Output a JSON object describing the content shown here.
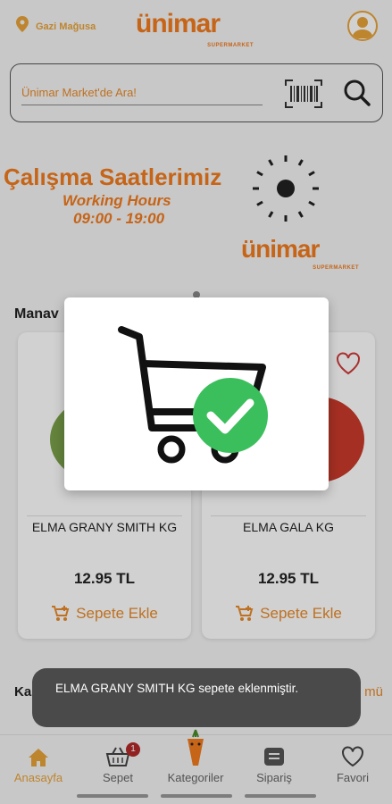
{
  "header": {
    "location": "Gazi Mağusa",
    "logo_text": "ünimar",
    "logo_sub": "SUPERMARKET"
  },
  "search": {
    "placeholder": "Ünimar Market'de Ara!"
  },
  "banner": {
    "title": "Çalışma Saatlerimiz",
    "subtitle": "Working Hours",
    "hours": "09:00 - 19:00",
    "logo_text": "ünimar",
    "logo_sub": "SUPERMARKET"
  },
  "section": {
    "title": "Manav"
  },
  "products": [
    {
      "name": "ELMA GRANY SMITH KG",
      "price": "12.95 TL",
      "add_label": "Sepete Ekle"
    },
    {
      "name": "ELMA GALA KG",
      "price": "12.95 TL",
      "add_label": "Sepete Ekle"
    }
  ],
  "section2": {
    "title": "Ka",
    "link": "mü"
  },
  "toast": {
    "message": "ELMA GRANY SMITH KG sepete eklenmiştir."
  },
  "nav": {
    "items": [
      {
        "label": "Anasayfa",
        "icon": "home-icon"
      },
      {
        "label": "Sepet",
        "icon": "basket-icon",
        "badge": "1"
      },
      {
        "label": "Kategoriler",
        "icon": "carrot-icon"
      },
      {
        "label": "Sipariş",
        "icon": "order-icon"
      },
      {
        "label": "Favori",
        "icon": "heart-icon"
      }
    ]
  },
  "colors": {
    "brand_orange": "#f27b1d",
    "accent_gold": "#e8a33a",
    "success_green": "#3bbf5c"
  }
}
